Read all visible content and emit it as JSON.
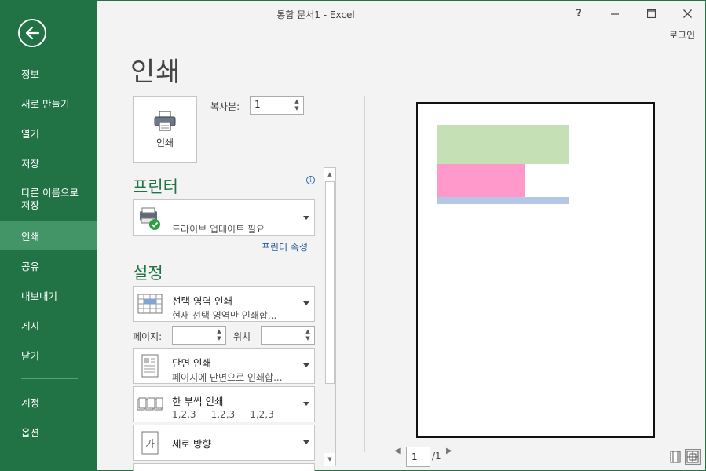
{
  "window": {
    "title": "통합 문서1 - Excel",
    "help": "?",
    "minimize": "—",
    "maximize": "☐",
    "close": "✕",
    "login": "로그인"
  },
  "sidebar": {
    "back_icon": "back-arrow-icon",
    "items": [
      {
        "label": "정보"
      },
      {
        "label": "새로 만들기"
      },
      {
        "label": "열기"
      },
      {
        "label": "저장"
      },
      {
        "label": "다른 이름으로 저장"
      },
      {
        "label": "인쇄",
        "active": true
      },
      {
        "label": "공유"
      },
      {
        "label": "내보내기"
      },
      {
        "label": "게시"
      },
      {
        "label": "닫기"
      },
      {
        "label": "계정"
      },
      {
        "label": "옵션"
      }
    ],
    "item_save_as_line1": "다른 이름으로",
    "item_save_as_line2": "저장"
  },
  "main": {
    "title": "인쇄",
    "print_button": "인쇄",
    "copies_label": "복사본:",
    "copies_value": "1",
    "printer": {
      "heading": "프린터",
      "info_icon": "i",
      "selected_name": "",
      "selected_status": "드라이브 업데이트 필요",
      "properties_link": "프린터 속성"
    },
    "settings": {
      "heading": "설정",
      "scope": {
        "title": "선택 영역 인쇄",
        "subtitle": "현재 선택 영역만 인쇄합..."
      },
      "pages_label": "페이지:",
      "pages_value": "",
      "to_label": "위치",
      "to_value": "",
      "sides": {
        "title": "단면 인쇄",
        "subtitle": "페이지에 단면으로 인쇄합..."
      },
      "collate": {
        "title": "한 부씩 인쇄",
        "subtitle": "1,2,3     1,2,3     1,2,3"
      },
      "orientation": {
        "title": "세로 방향"
      }
    }
  },
  "preview": {
    "page_current": "1",
    "page_total": "/1",
    "prev": "◀",
    "next": "▶",
    "colors": {
      "green": "#c5e0b4",
      "pink": "#ff99cc",
      "blue": "#b4c7e7"
    }
  }
}
